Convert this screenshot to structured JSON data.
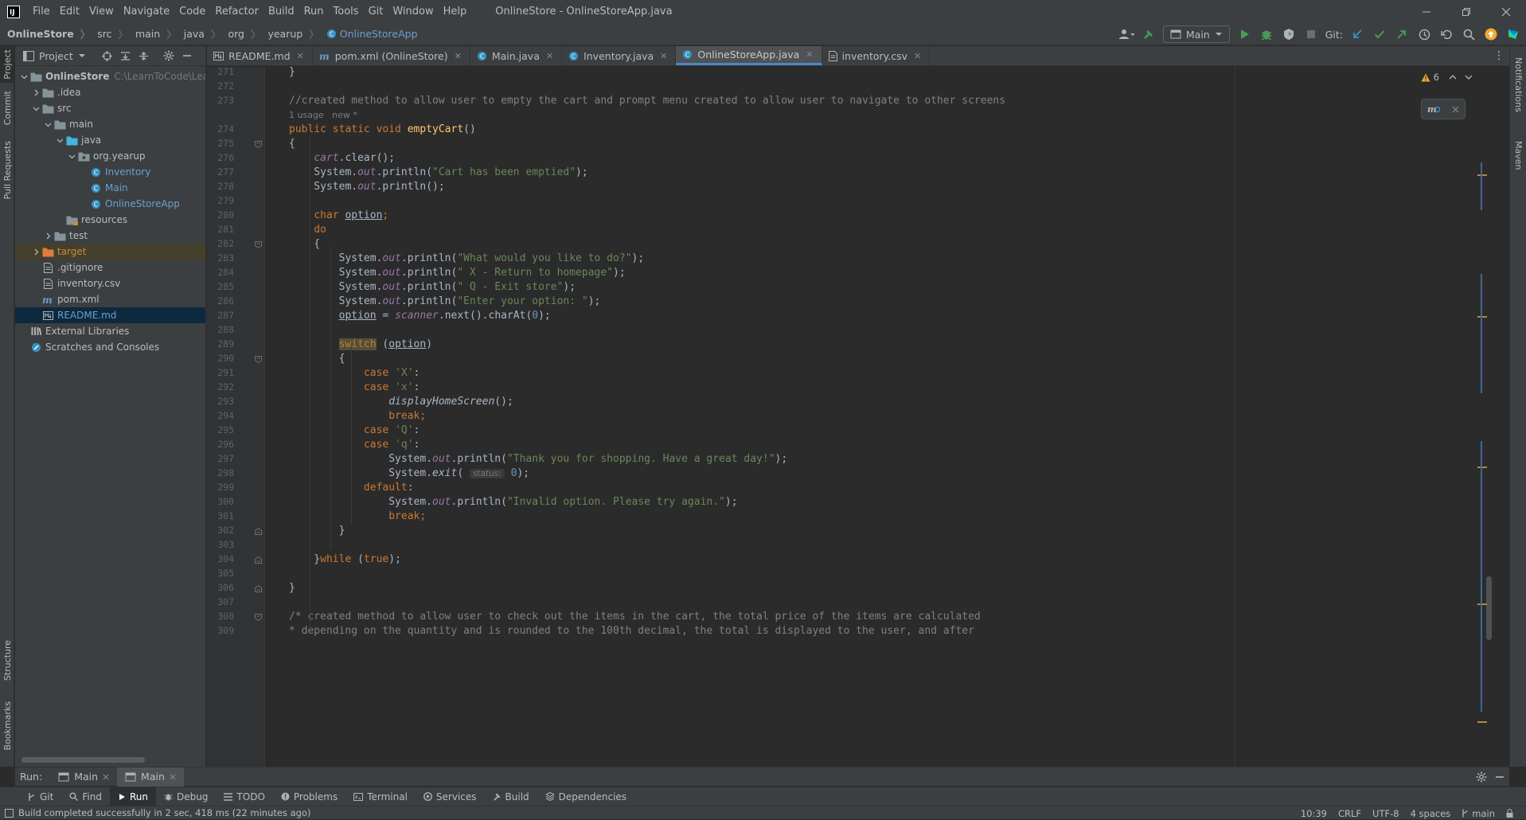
{
  "menu": [
    "File",
    "Edit",
    "View",
    "Navigate",
    "Code",
    "Refactor",
    "Build",
    "Run",
    "Tools",
    "Git",
    "Window",
    "Help"
  ],
  "window_title": "OnlineStore - OnlineStoreApp.java",
  "breadcrumbs": [
    "OnlineStore",
    "src",
    "main",
    "java",
    "org",
    "yearup",
    "OnlineStoreApp"
  ],
  "toolbar": {
    "run_config": "Main",
    "git_label": "Git:"
  },
  "side_tabs_left": {
    "project": "Project",
    "commit": "Commit",
    "pull_requests": "Pull Requests",
    "structure": "Structure",
    "bookmarks": "Bookmarks"
  },
  "side_tabs_right": {
    "notifications": "Notifications",
    "maven": "Maven"
  },
  "project_panel": {
    "title": "Project",
    "tree": [
      {
        "label": "OnlineStore",
        "extra": "C:\\LearnToCode\\LearnToC",
        "depth": 0,
        "icon": "folder",
        "expanded": true,
        "bold": true
      },
      {
        "label": ".idea",
        "depth": 1,
        "icon": "folder",
        "collapsed": true
      },
      {
        "label": "src",
        "depth": 1,
        "icon": "folder",
        "expanded": true
      },
      {
        "label": "main",
        "depth": 2,
        "icon": "folder",
        "expanded": true
      },
      {
        "label": "java",
        "depth": 3,
        "icon": "folder-src",
        "expanded": true
      },
      {
        "label": "org.yearup",
        "depth": 4,
        "icon": "package",
        "expanded": true
      },
      {
        "label": "Inventory",
        "depth": 5,
        "icon": "class",
        "color": "blue"
      },
      {
        "label": "Main",
        "depth": 5,
        "icon": "class",
        "color": "blue"
      },
      {
        "label": "OnlineStoreApp",
        "depth": 5,
        "icon": "class",
        "color": "blue"
      },
      {
        "label": "resources",
        "depth": 3,
        "icon": "folder-res"
      },
      {
        "label": "test",
        "depth": 2,
        "icon": "folder",
        "collapsed": true
      },
      {
        "label": "target",
        "depth": 1,
        "icon": "folder-excl",
        "collapsed": true,
        "state": "excluded"
      },
      {
        "label": ".gitignore",
        "depth": 1,
        "icon": "file"
      },
      {
        "label": "inventory.csv",
        "depth": 1,
        "icon": "file"
      },
      {
        "label": "pom.xml",
        "depth": 1,
        "icon": "maven"
      },
      {
        "label": "README.md",
        "depth": 1,
        "icon": "md",
        "state": "selected",
        "color": "blue"
      },
      {
        "label": "External Libraries",
        "depth": 0,
        "icon": "libs"
      },
      {
        "label": "Scratches and Consoles",
        "depth": 0,
        "icon": "scratch"
      }
    ]
  },
  "tabs": [
    {
      "label": "README.md",
      "icon": "md"
    },
    {
      "label": "pom.xml (OnlineStore)",
      "icon": "maven"
    },
    {
      "label": "Main.java",
      "icon": "class"
    },
    {
      "label": "Inventory.java",
      "icon": "class"
    },
    {
      "label": "OnlineStoreApp.java",
      "icon": "class",
      "active": true
    },
    {
      "label": "inventory.csv",
      "icon": "file"
    }
  ],
  "editor": {
    "warning_count": "6",
    "lines": [
      {
        "n": "271",
        "tokens": [
          [
            "",
            "}"
          ]
        ]
      },
      {
        "n": "272",
        "tokens": []
      },
      {
        "n": "273",
        "tokens": [
          [
            "cm",
            "//created method to allow user to empty the cart and prompt menu created to allow user to navigate to other screens"
          ]
        ]
      },
      {
        "hint": "1 usage   new *"
      },
      {
        "n": "274",
        "tokens": [
          [
            "kw",
            "public static void "
          ],
          [
            "mth",
            "emptyCart"
          ],
          [
            "",
            "()"
          ]
        ]
      },
      {
        "n": "275",
        "tokens": [
          [
            "",
            "{"
          ]
        ]
      },
      {
        "n": "276",
        "tokens": [
          [
            "",
            "    "
          ],
          [
            "fld",
            "cart"
          ],
          [
            "",
            ".clear();"
          ]
        ]
      },
      {
        "n": "277",
        "tokens": [
          [
            "",
            "    System."
          ],
          [
            "fld",
            "out"
          ],
          [
            "",
            ".println("
          ],
          [
            "str",
            "\"Cart has been emptied\""
          ],
          [
            "",
            ");"
          ]
        ]
      },
      {
        "n": "278",
        "tokens": [
          [
            "",
            "    System."
          ],
          [
            "fld",
            "out"
          ],
          [
            "",
            ".println();"
          ]
        ]
      },
      {
        "n": "279",
        "tokens": []
      },
      {
        "n": "280",
        "tokens": [
          [
            "",
            "    "
          ],
          [
            "kw",
            "char "
          ],
          [
            "und",
            "option"
          ],
          [
            "kw",
            ";"
          ]
        ]
      },
      {
        "n": "281",
        "tokens": [
          [
            "",
            "    "
          ],
          [
            "kw",
            "do"
          ]
        ]
      },
      {
        "n": "282",
        "tokens": [
          [
            "",
            "    {"
          ]
        ]
      },
      {
        "n": "283",
        "tokens": [
          [
            "",
            "        System."
          ],
          [
            "fld",
            "out"
          ],
          [
            "",
            ".println("
          ],
          [
            "str",
            "\"What would you like to do?\""
          ],
          [
            "",
            ");"
          ]
        ]
      },
      {
        "n": "284",
        "tokens": [
          [
            "",
            "        System."
          ],
          [
            "fld",
            "out"
          ],
          [
            "",
            ".println("
          ],
          [
            "str",
            "\" X - Return to homepage\""
          ],
          [
            "",
            ");"
          ]
        ]
      },
      {
        "n": "285",
        "tokens": [
          [
            "",
            "        System."
          ],
          [
            "fld",
            "out"
          ],
          [
            "",
            ".println("
          ],
          [
            "str",
            "\" Q - Exit store\""
          ],
          [
            "",
            ");"
          ]
        ]
      },
      {
        "n": "286",
        "tokens": [
          [
            "",
            "        System."
          ],
          [
            "fld",
            "out"
          ],
          [
            "",
            ".println("
          ],
          [
            "str",
            "\"Enter your option: \""
          ],
          [
            "",
            ");"
          ]
        ]
      },
      {
        "n": "287",
        "tokens": [
          [
            "",
            "        "
          ],
          [
            "und",
            "option"
          ],
          [
            "",
            " = "
          ],
          [
            "fld",
            "scanner"
          ],
          [
            "",
            ".next().charAt("
          ],
          [
            "num",
            "0"
          ],
          [
            "",
            ");"
          ]
        ]
      },
      {
        "n": "288",
        "tokens": []
      },
      {
        "n": "289",
        "tokens": [
          [
            "",
            "        "
          ],
          [
            "kwhl",
            "switch"
          ],
          [
            "",
            " ("
          ],
          [
            "und",
            "option"
          ],
          [
            "",
            ")"
          ]
        ]
      },
      {
        "n": "290",
        "tokens": [
          [
            "",
            "        {"
          ]
        ]
      },
      {
        "n": "291",
        "tokens": [
          [
            "",
            "            "
          ],
          [
            "kw",
            "case "
          ],
          [
            "str",
            "'X'"
          ],
          [
            "",
            ":"
          ]
        ]
      },
      {
        "n": "292",
        "tokens": [
          [
            "",
            "            "
          ],
          [
            "kw",
            "case "
          ],
          [
            "str",
            "'x'"
          ],
          [
            "",
            ":"
          ]
        ]
      },
      {
        "n": "293",
        "tokens": [
          [
            "",
            "                "
          ],
          [
            "sfn",
            "displayHomeScreen"
          ],
          [
            "",
            "();"
          ]
        ]
      },
      {
        "n": "294",
        "tokens": [
          [
            "",
            "                "
          ],
          [
            "kw",
            "break;"
          ]
        ]
      },
      {
        "n": "295",
        "tokens": [
          [
            "",
            "            "
          ],
          [
            "kw",
            "case "
          ],
          [
            "str",
            "'Q'"
          ],
          [
            "",
            ":"
          ]
        ]
      },
      {
        "n": "296",
        "tokens": [
          [
            "",
            "            "
          ],
          [
            "kw",
            "case "
          ],
          [
            "str",
            "'q'"
          ],
          [
            "",
            ":"
          ]
        ]
      },
      {
        "n": "297",
        "tokens": [
          [
            "",
            "                System."
          ],
          [
            "fld",
            "out"
          ],
          [
            "",
            ".println("
          ],
          [
            "str",
            "\"Thank you for shopping. Have a great day!\""
          ],
          [
            "",
            ");"
          ]
        ]
      },
      {
        "n": "298",
        "tokens": [
          [
            "",
            "                System."
          ],
          [
            "sfn",
            "exit"
          ],
          [
            "",
            "( "
          ],
          [
            "inlay",
            "status:"
          ],
          [
            "",
            " "
          ],
          [
            "num",
            "0"
          ],
          [
            "",
            ");"
          ]
        ]
      },
      {
        "n": "299",
        "tokens": [
          [
            "",
            "            "
          ],
          [
            "kw",
            "default"
          ],
          [
            "",
            ":"
          ]
        ]
      },
      {
        "n": "300",
        "tokens": [
          [
            "",
            "                System."
          ],
          [
            "fld",
            "out"
          ],
          [
            "",
            ".println("
          ],
          [
            "str",
            "\"Invalid option. Please try again.\""
          ],
          [
            "",
            ");"
          ]
        ]
      },
      {
        "n": "301",
        "tokens": [
          [
            "",
            "                "
          ],
          [
            "kw",
            "break;"
          ]
        ]
      },
      {
        "n": "302",
        "tokens": [
          [
            "",
            "        }"
          ]
        ]
      },
      {
        "n": "303",
        "tokens": []
      },
      {
        "n": "304",
        "tokens": [
          [
            "",
            "    }"
          ],
          [
            "kw",
            "while "
          ],
          [
            "",
            "("
          ],
          [
            "kw",
            "true"
          ],
          [
            "",
            ");"
          ]
        ]
      },
      {
        "n": "305",
        "tokens": []
      },
      {
        "n": "306",
        "tokens": [
          [
            "",
            "}"
          ]
        ]
      },
      {
        "n": "307",
        "tokens": []
      },
      {
        "n": "308",
        "tokens": [
          [
            "cm",
            "/* created method to allow user to check out the items in the cart, the total price of the items are calculated"
          ]
        ]
      },
      {
        "n": "309",
        "tokens": [
          [
            "cm",
            "* depending on the quantity and is rounded to the 100th decimal, the total is displayed to the user, and after"
          ]
        ]
      }
    ]
  },
  "run_bar": {
    "label": "Run:",
    "tabs": [
      "Main",
      "Main"
    ]
  },
  "tool_tabs": [
    "Git",
    "Find",
    "Run",
    "Debug",
    "TODO",
    "Problems",
    "Terminal",
    "Services",
    "Build",
    "Dependencies"
  ],
  "status": {
    "message": "Build completed successfully in 2 sec, 418 ms (22 minutes ago)",
    "position": "10:39",
    "line_sep": "CRLF",
    "encoding": "UTF-8",
    "indent": "4 spaces",
    "branch": "main"
  },
  "colors": {
    "accent": "#4a88c7",
    "keyword": "#cc7832",
    "string": "#6a8759",
    "method": "#ffc66d",
    "field": "#9876aa",
    "number": "#6897bb",
    "comment": "#808080",
    "panel": "#3c3f41",
    "editor": "#2b2b2b"
  }
}
